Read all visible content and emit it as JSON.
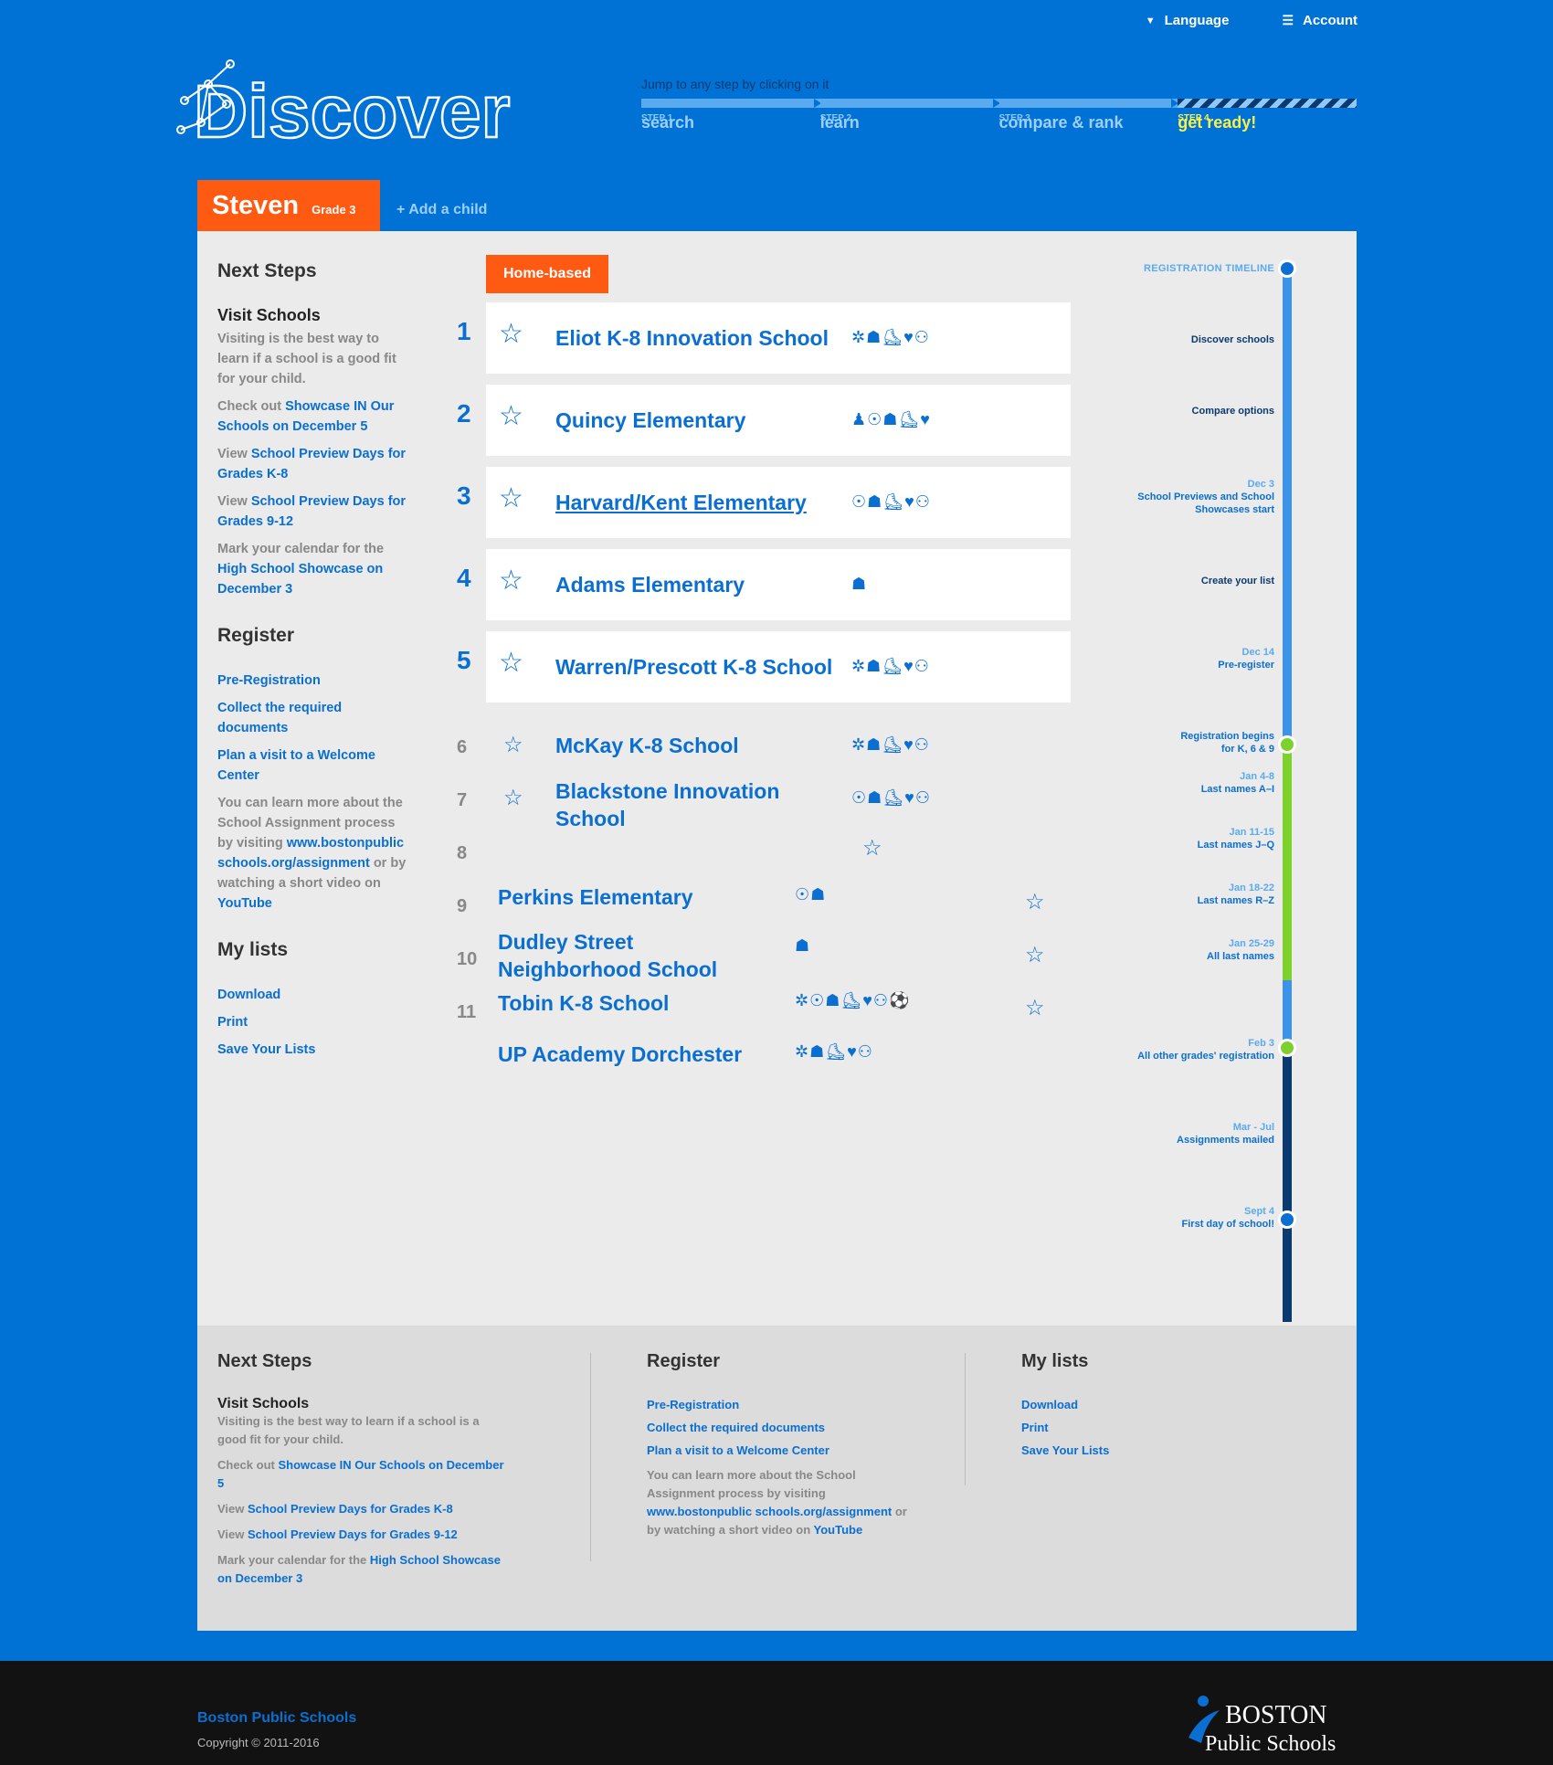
{
  "topnav": {
    "language": "Language",
    "account": "Account"
  },
  "logo": {
    "text": "Discover"
  },
  "steps": {
    "jump": "Jump to any step by clicking on it",
    "items": [
      {
        "num": "STEP 1",
        "name": "search"
      },
      {
        "num": "STEP 2",
        "name": "learn"
      },
      {
        "num": "STEP 3",
        "name": "compare & rank"
      },
      {
        "num": "STEP 4",
        "name": "get ready!"
      }
    ]
  },
  "child": {
    "name": "Steven",
    "grade": "Grade 3",
    "add": "+ Add a child"
  },
  "sidebar": {
    "next_steps": "Next Steps",
    "visit_title": "Visit Schools",
    "visit_text": "Visiting is the best way to learn if a school is a good fit for your child.",
    "check_out": "Check out",
    "showcase_link": "Showcase IN Our Schools on December 5",
    "view1": "View",
    "preview_k8": "School Preview Days for Grades K-8",
    "view2": "View",
    "preview_912": "School Preview Days for Grades 9-12",
    "mark": "Mark your calendar for the",
    "hs_showcase": "High School Showcase on December 3",
    "register": "Register",
    "prereg": "Pre-Registration",
    "collect": "Collect the required documents",
    "plan": "Plan a visit to a Welcome Center",
    "learn_more": "You can learn more about the School Assignment process by visiting",
    "url": "www.bostonpublic schools.org/assignment",
    "or": "or by watching a short video on",
    "youtube": "YouTube",
    "my_lists": "My lists",
    "download": "Download",
    "print": "Print",
    "save": "Save Your Lists"
  },
  "home_based": "Home-based",
  "ranked": [
    {
      "rank": "1",
      "name": "Eliot K-8 Innovation School",
      "icons": "✲☗⛸♥⚇"
    },
    {
      "rank": "2",
      "name": "Quincy Elementary",
      "icons": "♟☉☗⛸♥"
    },
    {
      "rank": "3",
      "name": "Harvard/Kent Elementary",
      "icons": "☉☗⛸♥⚇"
    },
    {
      "rank": "4",
      "name": "Adams Elementary",
      "icons": "☗"
    },
    {
      "rank": "5",
      "name": "Warren/Prescott K-8 School",
      "icons": "✲☗⛸♥⚇"
    }
  ],
  "unranked_a": [
    {
      "rank": "6",
      "name": "McKay K-8 School",
      "icons": "✲☗⛸♥⚇"
    },
    {
      "rank": "7",
      "name": "Blackstone Innovation School",
      "icons": "☉☗⛸♥⚇"
    },
    {
      "rank": "8"
    }
  ],
  "unranked_b": [
    {
      "rank": "9",
      "name": "Perkins Elementary",
      "icons": "☉☗"
    },
    {
      "rank": "10",
      "name": "Dudley Street Neighborhood School",
      "icons": "☗"
    },
    {
      "rank": "11",
      "name": "Tobin K-8 School",
      "icons": "✲☉☗⛸♥⚇⚽"
    },
    {
      "name": "UP Academy Dorchester",
      "icons": "✲☗⛸♥⚇"
    }
  ],
  "timeline": {
    "title": "REGISTRATION TIMELINE",
    "events": [
      {
        "date": "",
        "text": "Discover schools"
      },
      {
        "date": "",
        "text": "Compare options"
      },
      {
        "date": "Dec 3",
        "text": "School Previews and School Showcases start"
      },
      {
        "date": "",
        "text": "Create your list"
      },
      {
        "date": "Dec 14",
        "text": "Pre-register"
      },
      {
        "date": "",
        "text": "Registration begins for K, 6 & 9"
      },
      {
        "date": "Jan 4-8",
        "text": "Last names A–I"
      },
      {
        "date": "Jan 11-15",
        "text": "Last names J–Q"
      },
      {
        "date": "Jan 18-22",
        "text": "Last names R–Z"
      },
      {
        "date": "Jan 25-29",
        "text": "All last names"
      },
      {
        "date": "Feb 3",
        "text": "All other grades' registration"
      },
      {
        "date": "Mar - Jul",
        "text": "Assignments mailed"
      },
      {
        "date": "Sept 4",
        "text": "First day of school!"
      }
    ],
    "colors": {
      "light": "#3d93e8",
      "green": "#7cd12c",
      "dark": "#0a3a70"
    }
  },
  "footer": {
    "next_steps": "Next Steps",
    "visit_title": "Visit Schools",
    "visit_text": "Visiting is the best way to learn if a school is a good fit for your child.",
    "check_out": "Check out",
    "showcase_link": "Showcase IN Our Schools on December 5",
    "view1": "View",
    "preview_k8": "School Preview Days for Grades K-8",
    "view2": "View",
    "preview_912": "School Preview Days for Grades 9-12",
    "mark": "Mark your calendar for the",
    "hs_showcase": "High School Showcase on December 3",
    "register": "Register",
    "prereg": "Pre-Registration",
    "collect": "Collect the required documents",
    "plan": "Plan a visit to a Welcome Center",
    "learn_more": "You can learn more about the School Assignment process by visiting",
    "url": "www.bostonpublic schools.org/assignment",
    "or": "or by watching a short video on",
    "youtube": "YouTube",
    "my_lists": "My lists",
    "download": "Download",
    "print": "Print",
    "save": "Save Your Lists"
  },
  "bottom": {
    "org": "Boston Public Schools",
    "copyright": "Copyright © 2011-2016",
    "logo_line1": "BOSTON",
    "logo_line2": "Public Schools"
  }
}
